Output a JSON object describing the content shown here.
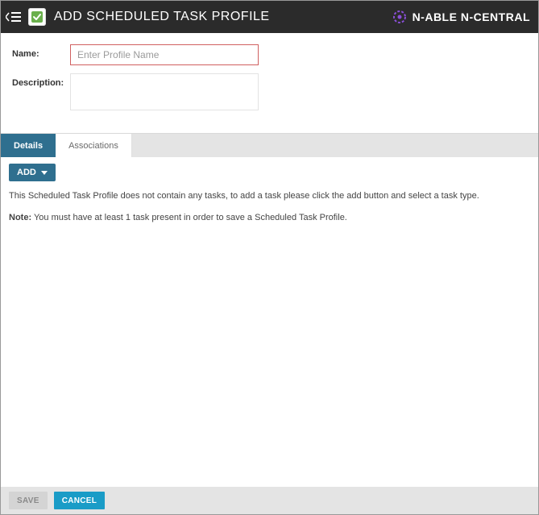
{
  "header": {
    "title": "ADD SCHEDULED TASK PROFILE",
    "brand": "N-ABLE N-CENTRAL"
  },
  "form": {
    "name_label": "Name:",
    "name_placeholder": "Enter Profile Name",
    "name_value": "",
    "description_label": "Description:",
    "description_value": ""
  },
  "tabs": {
    "details": "Details",
    "associations": "Associations"
  },
  "details": {
    "add_label": "ADD",
    "empty_text": "This Scheduled Task Profile does not contain any tasks, to add a task please click the add button and select a task type.",
    "note_label": "Note:",
    "note_text": "You must have at least 1 task present in order to save a Scheduled Task Profile."
  },
  "footer": {
    "save": "SAVE",
    "cancel": "CANCEL"
  }
}
